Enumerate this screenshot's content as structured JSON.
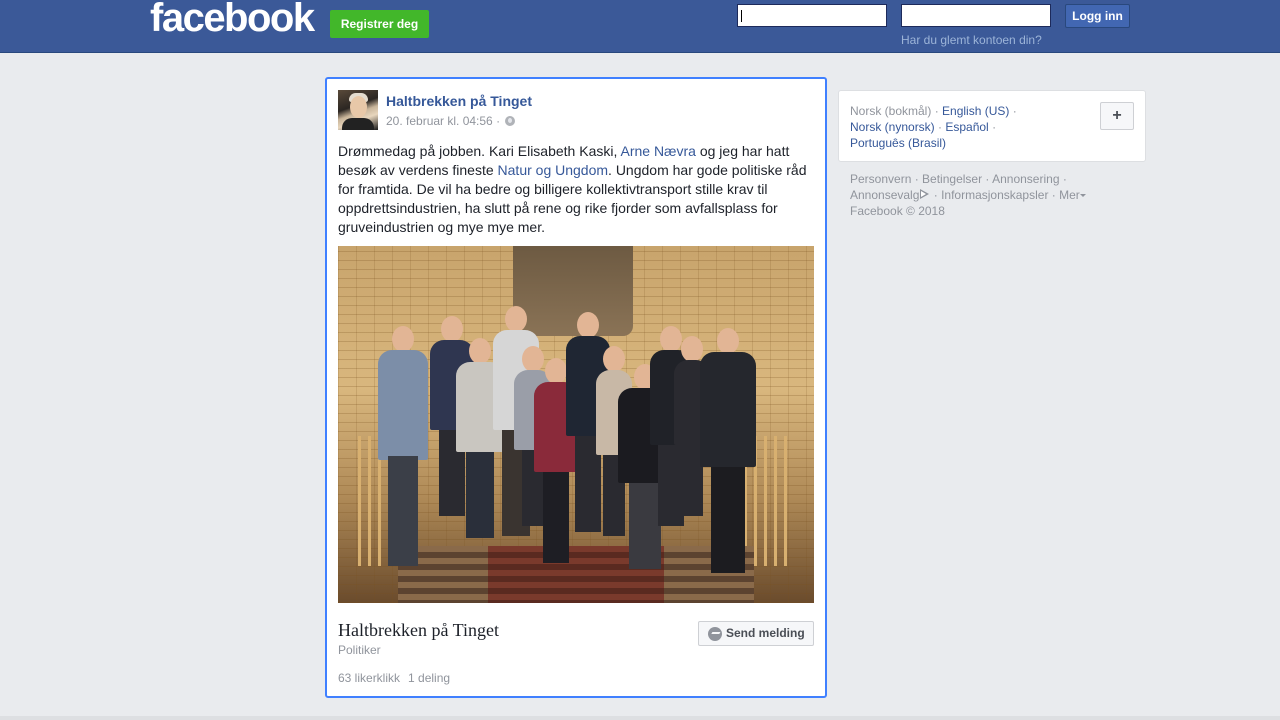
{
  "header": {
    "logo": "facebook",
    "register_label": "Registrer deg",
    "email_value": "",
    "password_value": "",
    "login_label": "Logg inn",
    "forgot_label": "Har du glemt kontoen din?"
  },
  "post": {
    "page_name": "Haltbrekken på Tinget",
    "date": "20. februar kl. 04:56",
    "meta_sep": " · ",
    "text_1": "Drømmedag på jobben. Kari Elisabeth Kaski, ",
    "link_1": "Arne Nævra",
    "text_2": " og jeg har hatt besøk av verdens fineste ",
    "link_2": "Natur og Ungdom",
    "text_3": ". Ungdom har gode politiske råd for framtida. De vil ha bedre og billigere kollektivtransport stille krav til oppdrettsindustrien, ha slutt på rene og rike fjorder som avfallsplass for gruveindustrien og mye mye mer.",
    "footer_name": "Haltbrekken på Tinget",
    "category": "Politiker",
    "likes": "63 likerklikk",
    "shares": "1 deling",
    "send_label": "Send melding"
  },
  "languages": {
    "current": "Norsk (bokmål)",
    "options": [
      "English (US)",
      "Norsk (nynorsk)",
      "Español",
      "Português (Brasil)"
    ],
    "sep": " · ",
    "more_label": "+"
  },
  "footer": {
    "links": [
      "Personvern",
      "Betingelser",
      "Annonsering",
      "Annonsevalg",
      "Informasjonskapsler",
      "Mer"
    ],
    "sep": " · ",
    "copyright": "Facebook © 2018"
  },
  "colors": {
    "brand": "#3b5998",
    "register": "#42b72a",
    "link": "#365899",
    "card_focus": "#4080ff"
  }
}
